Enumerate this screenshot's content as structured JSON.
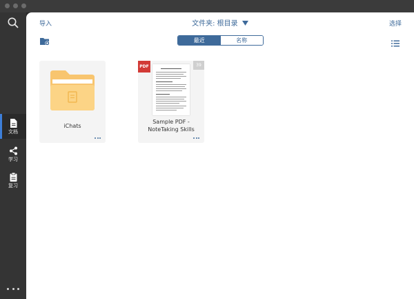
{
  "toolbar": {
    "import_label": "导入",
    "folder_label": "文件夹: 根目录",
    "select_label": "选择"
  },
  "segmented": {
    "recent_label": "最近",
    "name_label": "名称"
  },
  "sidebar": {
    "items": [
      {
        "label": "文档",
        "icon": "document-icon",
        "active": true
      },
      {
        "label": "学习",
        "icon": "share-nodes-icon",
        "active": false
      },
      {
        "label": "复习",
        "icon": "clipboard-icon",
        "active": false
      }
    ]
  },
  "files": [
    {
      "name": "iChats",
      "type": "folder"
    },
    {
      "name_line1": "Sample PDF -",
      "name_line2": "NoteTaking Skills",
      "type": "pdf",
      "badge": "PDF",
      "page_count": "39"
    }
  ],
  "colors": {
    "accent": "#3e6a9a",
    "sidebar_active": "#3d7fd9",
    "folder": "#f8c56f",
    "pdf_badge": "#d23a36"
  }
}
